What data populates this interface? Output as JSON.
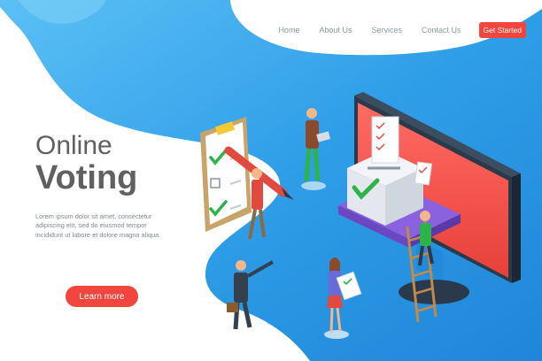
{
  "nav": {
    "home": "Home",
    "about": "About Us",
    "services": "Services",
    "contact": "Contact Us",
    "cta": "Get Started"
  },
  "hero": {
    "title_line1": "Online",
    "title_line2": "Voting",
    "description": "Lorem ipsum dolor sit amet, consectetur adipiscing elit, sed do eiusmod tempor incididunt ut labore et dolore magna aliqua.",
    "button": "Learn more"
  },
  "colors": {
    "accent": "#f2453d",
    "sky_blue": "#2f9ee8",
    "text_gray": "#606060"
  },
  "illustration": {
    "icons": [
      "clipboard-icon",
      "ballot-box-icon",
      "monitor-icon",
      "check-mark-icon",
      "ladder-icon",
      "briefcase-icon"
    ]
  }
}
